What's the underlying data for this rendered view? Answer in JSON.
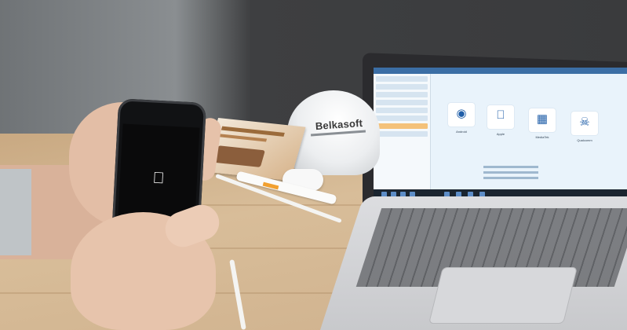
{
  "cap": {
    "brand": "Belkasoft"
  },
  "laptop_screen": {
    "tiles": [
      "Android",
      "Apple",
      "MediaTek",
      "Qualcomm"
    ]
  },
  "phone": {
    "logo": "apple-logo"
  },
  "colors": {
    "wall": "#3a3b3d",
    "table": "#d8bd99",
    "screen_bg": "#e9f3fb",
    "accent": "#1f5ea8"
  }
}
